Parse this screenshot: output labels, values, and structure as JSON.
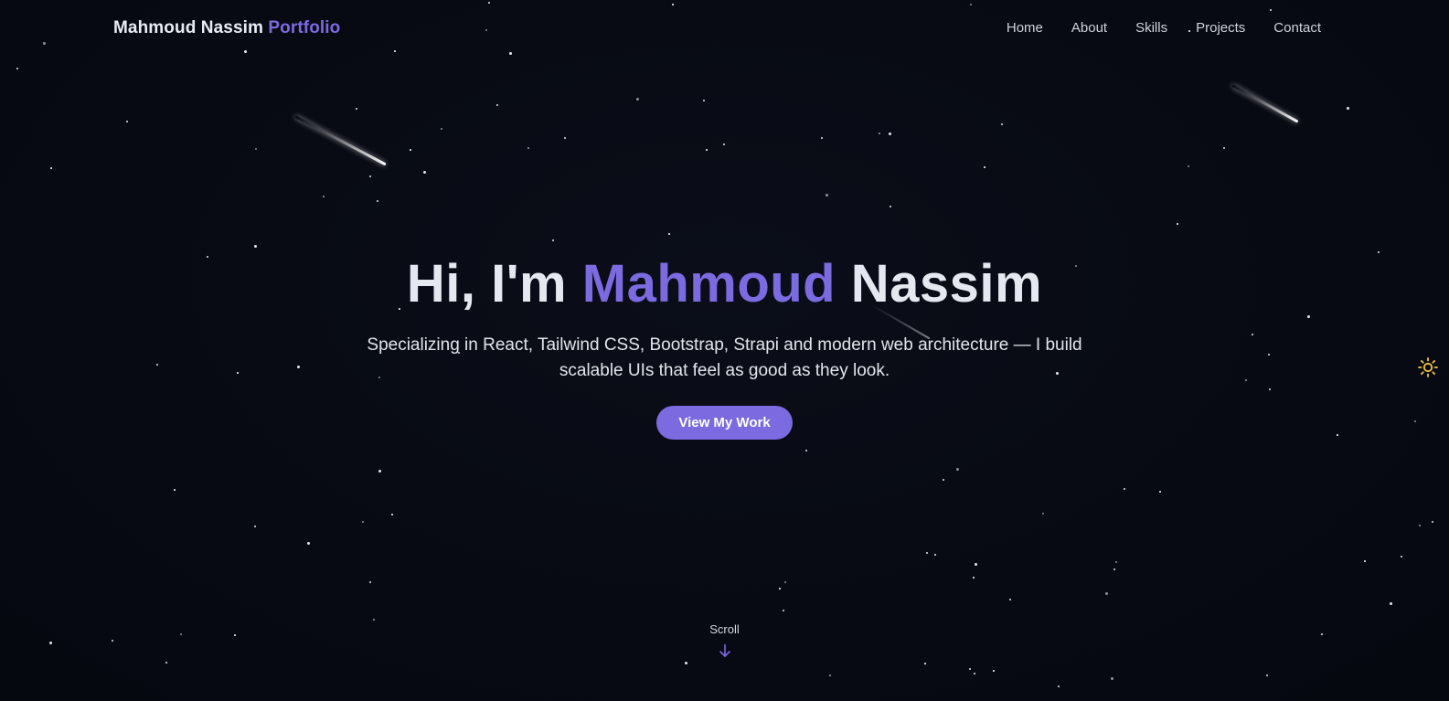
{
  "brand": {
    "name": "Mahmoud Nassim",
    "accent": "Portfolio"
  },
  "nav": {
    "items": [
      {
        "label": "Home"
      },
      {
        "label": "About"
      },
      {
        "label": "Skills"
      },
      {
        "label": "Projects"
      },
      {
        "label": "Contact"
      }
    ]
  },
  "hero": {
    "greeting": "Hi, I'm",
    "first_name": "Mahmoud",
    "last_name": "Nassim",
    "subtitle": "Specializing in React, Tailwind CSS, Bootstrap, Strapi and modern web architecture — I build scalable UIs that feel as good as they look.",
    "cta_label": "View My Work"
  },
  "scroll": {
    "label": "Scroll",
    "icon": "arrow-down-icon"
  },
  "theme_toggle": {
    "icon": "sun-icon"
  },
  "colors": {
    "background": "#070a12",
    "accent": "#7c6ae0",
    "text": "#e6e8f0",
    "sun": "#f5c542"
  }
}
